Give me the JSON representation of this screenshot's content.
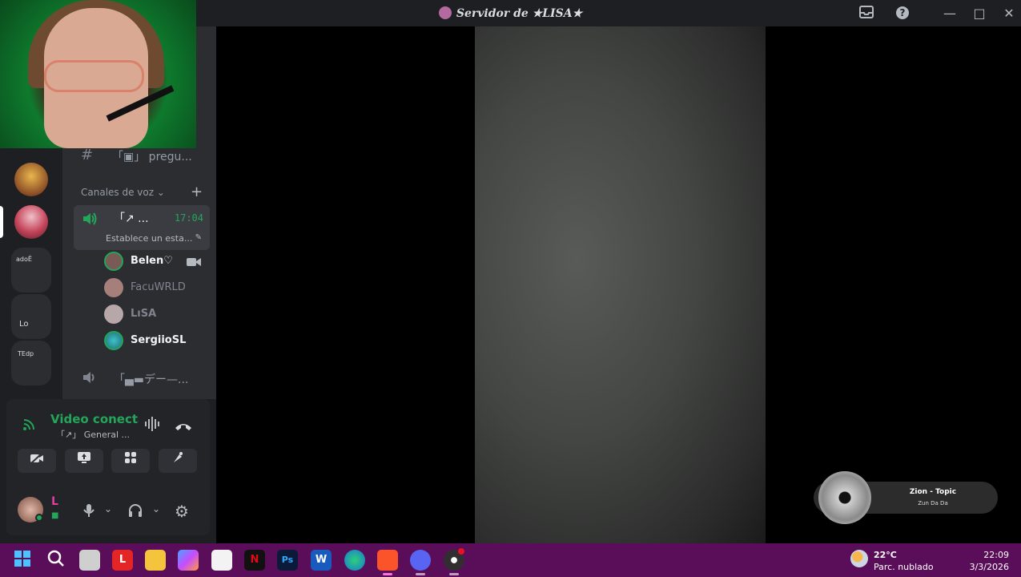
{
  "window": {
    "title": "Servidor de ★LISA★",
    "controls": {
      "inbox_icon": "inbox-icon",
      "help_icon": "help-icon",
      "minimize": "—",
      "maximize": "□",
      "close": "✕"
    }
  },
  "sidebar": {
    "text_channel_partial": "「▣」 pregu...",
    "voice_category": "Canales de voz",
    "voice_channel": {
      "name": "「↗ ...",
      "time": "17:04",
      "status": "Establece un esta..."
    },
    "members": [
      {
        "name": "Belen♡",
        "color": "#f2f3f5"
      },
      {
        "name": "FacuWRLD",
        "color": "#80848e"
      },
      {
        "name": "LıSA",
        "color": "#80848e"
      },
      {
        "name": "SergiioSL",
        "color": "#f2f3f5"
      }
    ],
    "voice_channel_2": "「▄▬デー—..."
  },
  "servers": {
    "folder1_label": "adoË",
    "folder2_label": "Lo",
    "folder3_label": "TEdp"
  },
  "voice_panel": {
    "status": "Video conectado",
    "channel": "「↗」 General ...",
    "user_name": "L"
  },
  "now_playing": {
    "title": "Zion - Topic",
    "subtitle": "Zun Da Da"
  },
  "taskbar": {
    "apps": [
      "start",
      "search",
      "task-view",
      "L",
      "files",
      "copilot",
      "store",
      "N",
      "Ps",
      "W",
      "edge",
      "brave",
      "discord",
      "obs"
    ],
    "weather_temp": "22°C",
    "weather_desc": "Parc. nublado",
    "time": "22:09",
    "date": "3/3/2026"
  },
  "colors": {
    "discord_bg": "#1e1f22",
    "sidebar_bg": "#2b2d31",
    "green": "#23a55a",
    "taskbar": "#5a0e59"
  }
}
